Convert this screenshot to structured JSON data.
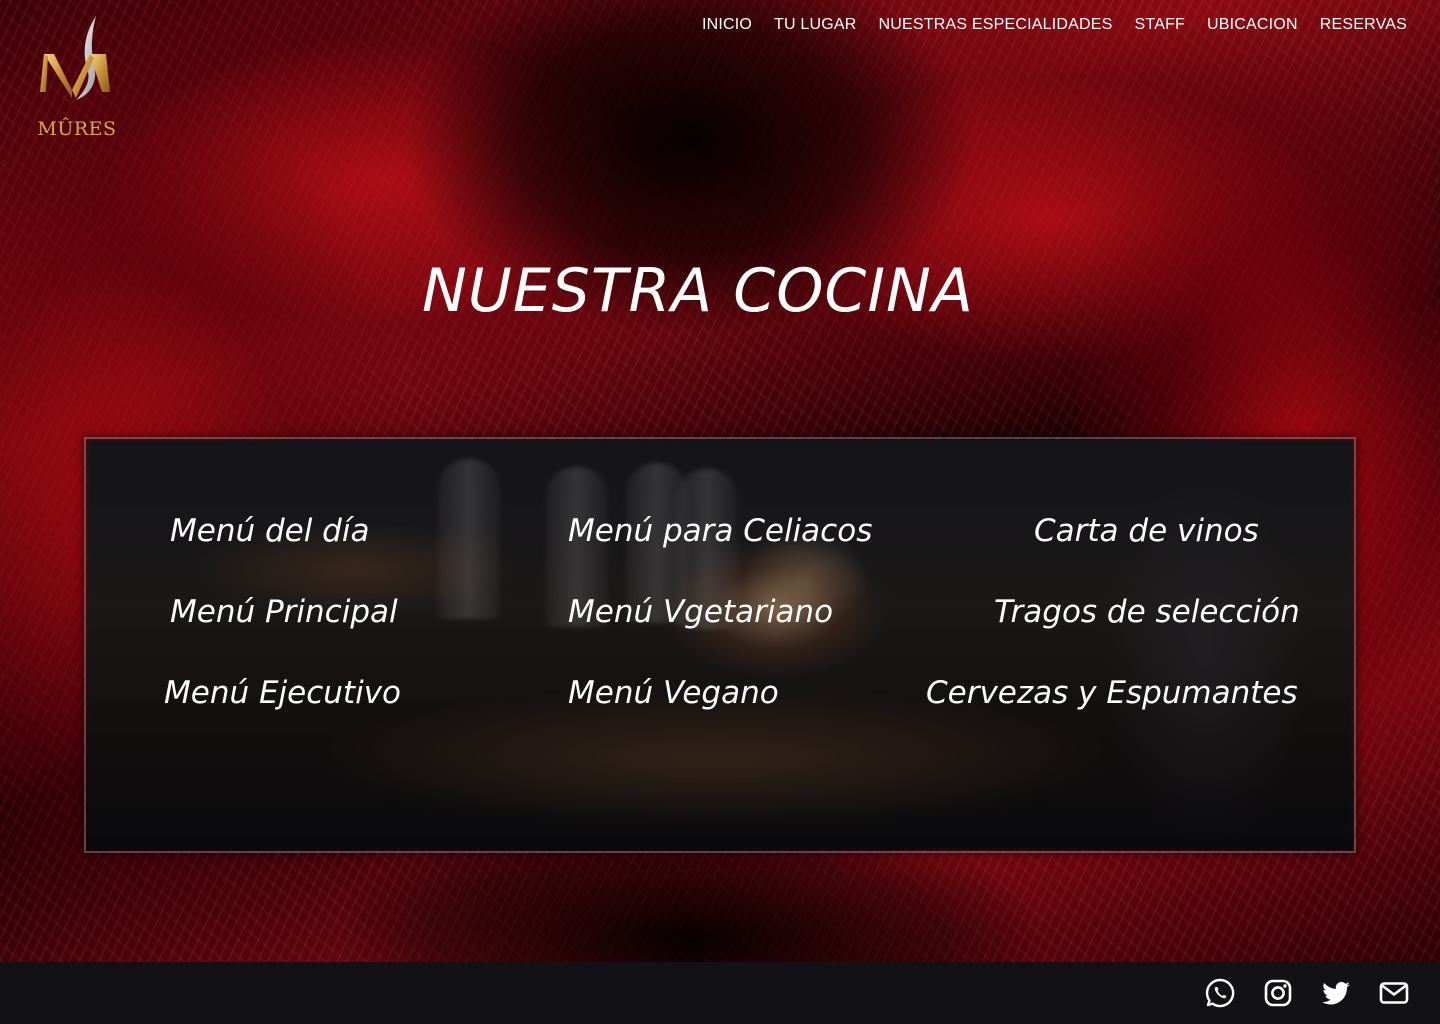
{
  "brand": {
    "name": "MÛRES",
    "monogram": "M",
    "gold": "#d7a84a"
  },
  "nav": {
    "items": [
      {
        "label": "INICIO"
      },
      {
        "label": "TU LUGAR"
      },
      {
        "label": "NUESTRAS ESPECIALIDADES"
      },
      {
        "label": "STAFF"
      },
      {
        "label": "UBICACION"
      },
      {
        "label": "RESERVAS"
      }
    ]
  },
  "main": {
    "title": "NUESTRA COCINA",
    "menus": [
      {
        "label": "Menú del día"
      },
      {
        "label": "Menú para Celiacos"
      },
      {
        "label": "Carta de vinos"
      },
      {
        "label": "Menú Principal"
      },
      {
        "label": "Menú Vgetariano"
      },
      {
        "label": "Tragos de selección"
      },
      {
        "label": "Menú Ejecutivo"
      },
      {
        "label": "Menú Vegano"
      },
      {
        "label": "Cervezas y Espumantes"
      }
    ]
  },
  "footer": {
    "icons": [
      "whatsapp-icon",
      "instagram-icon",
      "twitter-icon",
      "mail-icon"
    ]
  },
  "colors": {
    "accent_red": "#b00a14",
    "footer_bg": "#111116",
    "text": "#ffffff"
  }
}
